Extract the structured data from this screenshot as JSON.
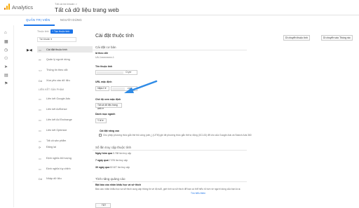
{
  "header": {
    "app_title": "Analytics",
    "account_path": "Tất cả tài khoản >",
    "account_name": "Tất cả dữ liệu trang web",
    "caret": "▾"
  },
  "tabs": [
    {
      "label": "QUẢN TRỊ VIÊN",
      "active": true
    },
    {
      "label": "NGƯỜI DÙNG",
      "active": false
    }
  ],
  "left_panel": {
    "property_heading": "Thuộc tính",
    "create_button": "+ Tạo thuộc tính",
    "property_select": "Tài khoản ▾",
    "back_icon": "▶◀",
    "nav_items": [
      {
        "icon": "▭",
        "label": "Cài đặt thuộc tính",
        "selected": true
      },
      {
        "icon": "⚯",
        "label": "Quản lý người dùng",
        "selected": false
      },
      {
        "icon": "<>",
        "label": "Thông tin theo dõi",
        "selected": false
      },
      {
        "icon": "Dd",
        "label": "Xóa yêu cầu dữ liệu",
        "selected": false
      }
    ],
    "section_label": "LIÊN KẾT SẢN PHẨM",
    "product_links": [
      {
        "icon": "▭",
        "label": "Liên kết Google Ads"
      },
      {
        "icon": "▭",
        "label": "Liên kết AdSense"
      },
      {
        "icon": "▭",
        "label": "Liên kết Ad Exchange"
      },
      {
        "icon": "▭",
        "label": "Liên kết Optimize"
      },
      {
        "icon": "▭",
        "label": "Tất cả sản phẩm"
      }
    ],
    "other_items": [
      {
        "icon": "⟳",
        "label": "Đăng lại"
      },
      {
        "icon": "▭",
        "label": "Định nghĩa đối tượng"
      },
      {
        "icon": "▭",
        "label": "Định nghĩa tùy chỉnh"
      },
      {
        "icon": "Dd",
        "label": "Nhập dữ liệu"
      }
    ]
  },
  "rail_icons": [
    "⌂",
    "▦",
    "◷",
    "⚇",
    "➤",
    "▤",
    "⚑"
  ],
  "content": {
    "title": "Cài đặt thuộc tính",
    "buttons": [
      "Di chuyển thuộc tính",
      "Di chuyển vào Thùng rác"
    ],
    "basic_section": "Cài đặt cơ bản",
    "id_label": "Id theo dõi",
    "id_value": "UA-1xxxxxxxxx-1",
    "name_label": "Tên thuộc tính",
    "name_value": "Cryer",
    "url_label": "URL mặc định",
    "url_protocol": "https:// ▾",
    "url_suffix": ".com",
    "view_label": "Chế độ xem mặc định",
    "view_value": "Tất cả dữ liệu trang web ▾",
    "industry_label": "Danh mục ngành",
    "industry_value": "Y tế ▾",
    "advanced_label": "Cài đặt nâng cao",
    "advanced_text": "Cho phép phương thức gắn thẻ thủ công (utm_) (UTM) ghi đè phương thức gắn thẻ tự động (GCLID) để chú của Google Ads và Search Ads 360",
    "visits_section": "Số lần truy cập thuộc tính",
    "visits": [
      {
        "label": "Ngày hôm qua",
        "value": "5.768 lần truy cập"
      },
      {
        "label": "7 ngày qua",
        "value": "17.576 lần truy cập"
      },
      {
        "label": "30 ngày qua",
        "value": "82.627 lần truy cập"
      }
    ],
    "ads_section": "Tính năng quảng cáo",
    "ads_label": "Bật báo cáo nhân khẩu học và sở thích",
    "ads_text": "Báo cáo nhân khẩu học và sở thích cung cấp thông tin về độ tuổi, giới tính và sở thích để bạn có thể hiểu rõ hơn về người dùng của bạn là ai.",
    "ads_link": "Tìm hiểu thêm",
    "toggle_label": "TẮT"
  }
}
